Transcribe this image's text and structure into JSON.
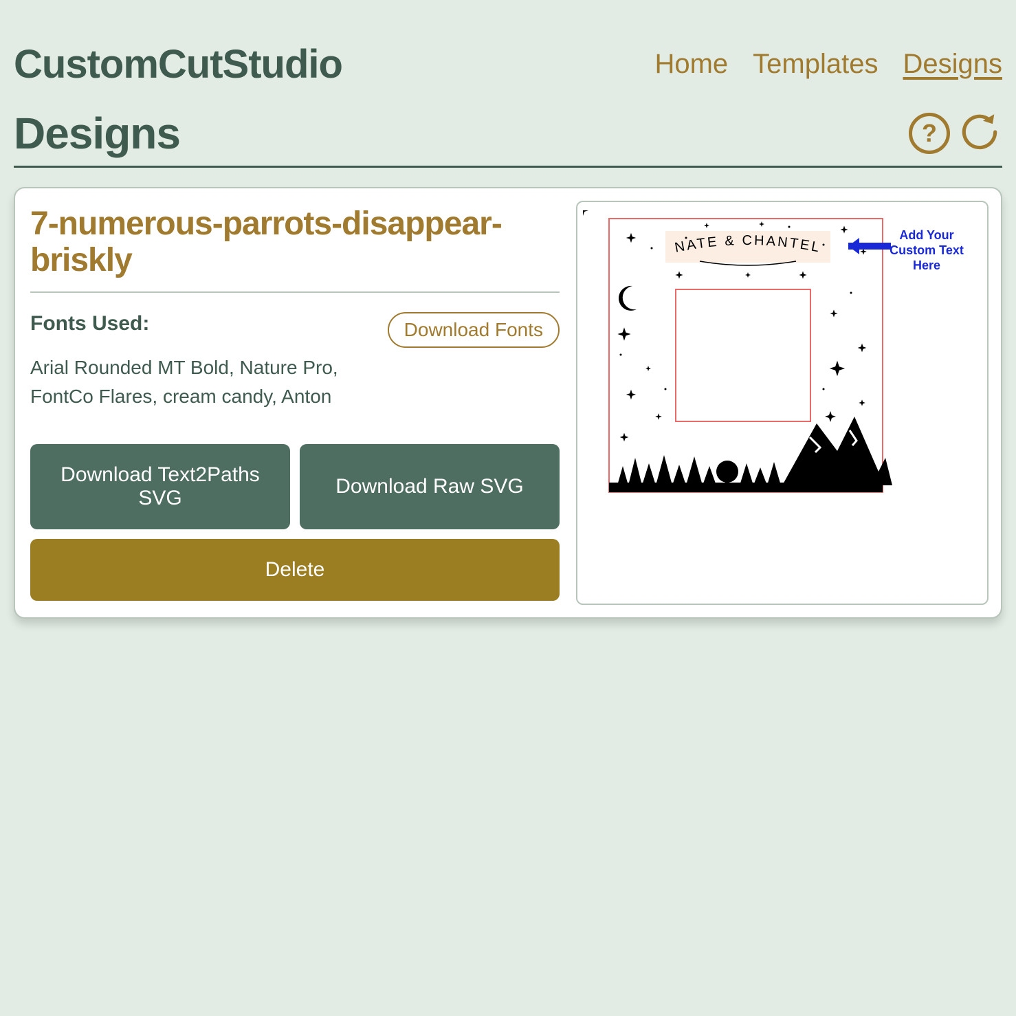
{
  "header": {
    "logo": "CustomCutStudio",
    "nav": {
      "home": "Home",
      "templates": "Templates",
      "designs": "Designs"
    }
  },
  "page": {
    "title": "Designs"
  },
  "design": {
    "name": "7-numerous-parrots-disappear-briskly",
    "fonts_label": "Fonts Used:",
    "fonts_list": "Arial Rounded MT Bold, Nature Pro, FontCo Flares, cream candy, Anton",
    "download_fonts_btn": "Download Fonts",
    "download_text2paths_btn": "Download Text2Paths SVG",
    "download_raw_btn": "Download Raw SVG",
    "delete_btn": "Delete"
  },
  "preview": {
    "banner_text": "NATE & CHANTEL",
    "callout_line1": "Add Your",
    "callout_line2": "Custom Text",
    "callout_line3": "Here"
  },
  "colors": {
    "accent_gold": "#a07a2e",
    "accent_green": "#3f5a4e",
    "btn_green": "#4f6e62",
    "btn_gold": "#9c7e22",
    "callout_blue": "#1a29d6",
    "preview_border": "#ea6a6a"
  }
}
